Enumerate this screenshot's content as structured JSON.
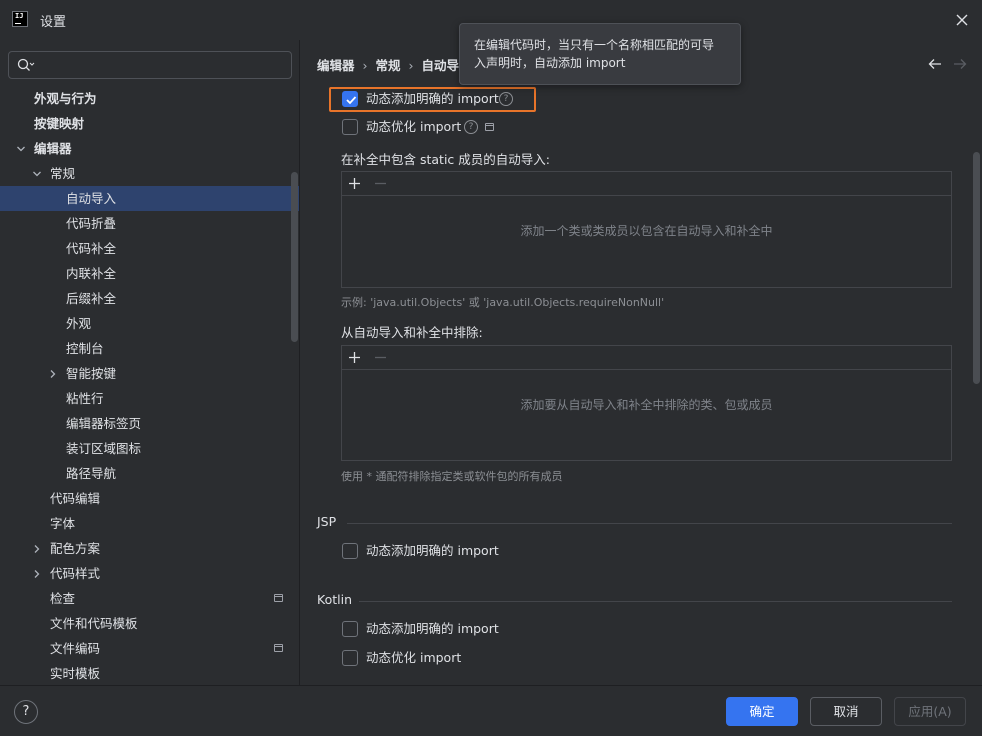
{
  "window": {
    "title": "设置",
    "logo_text": "IJ"
  },
  "search": {
    "placeholder": "",
    "value": ""
  },
  "sidebar": {
    "items": [
      {
        "label": "外观与行为",
        "level": 0,
        "bold": true,
        "arrow": "none"
      },
      {
        "label": "按键映射",
        "level": 0,
        "bold": true,
        "arrow": "none"
      },
      {
        "label": "编辑器",
        "level": 0,
        "bold": true,
        "arrow": "expanded"
      },
      {
        "label": "常规",
        "level": 1,
        "arrow": "expanded"
      },
      {
        "label": "自动导入",
        "level": 2,
        "selected": true,
        "arrow": "none"
      },
      {
        "label": "代码折叠",
        "level": 2,
        "arrow": "none"
      },
      {
        "label": "代码补全",
        "level": 2,
        "arrow": "none"
      },
      {
        "label": "内联补全",
        "level": 2,
        "arrow": "none"
      },
      {
        "label": "后缀补全",
        "level": 2,
        "arrow": "none"
      },
      {
        "label": "外观",
        "level": 2,
        "arrow": "none"
      },
      {
        "label": "控制台",
        "level": 2,
        "arrow": "none"
      },
      {
        "label": "智能按键",
        "level": 2,
        "arrow": "collapsed"
      },
      {
        "label": "粘性行",
        "level": 2,
        "arrow": "none"
      },
      {
        "label": "编辑器标签页",
        "level": 2,
        "arrow": "none"
      },
      {
        "label": "装订区域图标",
        "level": 2,
        "arrow": "none"
      },
      {
        "label": "路径导航",
        "level": 2,
        "arrow": "none"
      },
      {
        "label": "代码编辑",
        "level": 1,
        "arrow": "none"
      },
      {
        "label": "字体",
        "level": 1,
        "arrow": "none"
      },
      {
        "label": "配色方案",
        "level": 1,
        "arrow": "collapsed"
      },
      {
        "label": "代码样式",
        "level": 1,
        "arrow": "collapsed"
      },
      {
        "label": "检查",
        "level": 1,
        "arrow": "none",
        "project_icon": true
      },
      {
        "label": "文件和代码模板",
        "level": 1,
        "arrow": "none"
      },
      {
        "label": "文件编码",
        "level": 1,
        "arrow": "none",
        "project_icon": true
      },
      {
        "label": "实时模板",
        "level": 1,
        "arrow": "none"
      }
    ]
  },
  "breadcrumb": {
    "part1": "编辑器",
    "part2": "常规",
    "part3": "自动导",
    "separator": "›"
  },
  "tooltip": {
    "line1": "在编辑代码时，当只有一个名称相匹配的可导",
    "line2": "入声明时，自动添加 import"
  },
  "java": {
    "add_unambiguous_label": "动态添加明确的 import",
    "add_unambiguous_checked": true,
    "optimize_label": "动态优化 import",
    "optimize_checked": false,
    "static_members_title": "在补全中包含 static 成员的自动导入:",
    "static_members_empty": "添加一个类或类成员以包含在自动导入和补全中",
    "static_members_hint": "示例: 'java.util.Objects' 或 'java.util.Objects.requireNonNull'",
    "exclude_title": "从自动导入和补全中排除:",
    "exclude_empty": "添加要从自动导入和补全中排除的类、包或成员",
    "exclude_hint": "使用 * 通配符排除指定类或软件包的所有成员"
  },
  "jsp": {
    "title": "JSP",
    "add_unambiguous_label": "动态添加明确的 import",
    "add_unambiguous_checked": false
  },
  "kotlin": {
    "title": "Kotlin",
    "add_unambiguous_label": "动态添加明确的 import",
    "add_unambiguous_checked": false,
    "optimize_label": "动态优化 import",
    "optimize_checked": false
  },
  "footer": {
    "help_label": "?",
    "ok_label": "确定",
    "cancel_label": "取消",
    "apply_label": "应用(A)"
  },
  "colors": {
    "accent": "#3574f0",
    "highlight": "#e8742a",
    "selected_row": "#2e436e",
    "background": "#2b2d30"
  }
}
